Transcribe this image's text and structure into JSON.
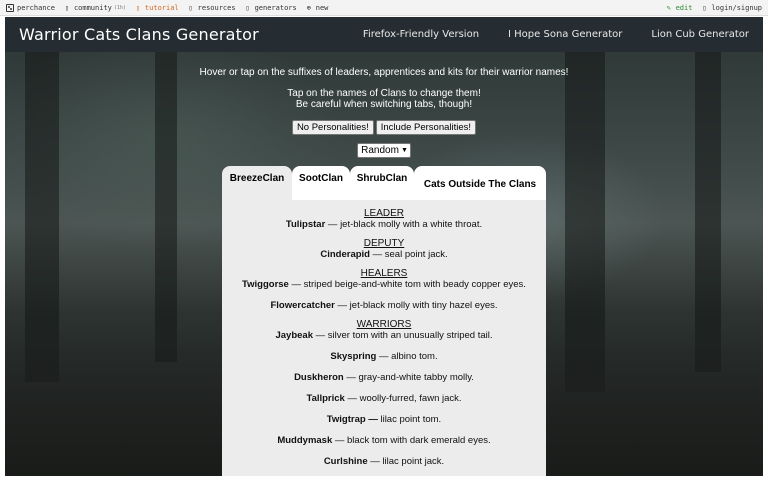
{
  "topbar": {
    "items": [
      {
        "icon": "dice-icon",
        "label": "perchance"
      },
      {
        "icon": "chat-icon",
        "label": "community",
        "badge": "(1h)"
      },
      {
        "icon": "book-icon",
        "label": "tutorial"
      },
      {
        "icon": "box-icon",
        "label": "resources"
      },
      {
        "icon": "gear-icon",
        "label": "generators"
      },
      {
        "icon": "plus-circle-icon",
        "label": "new"
      }
    ],
    "edit_label": "edit",
    "login_label": "login/signup",
    "colors": {
      "tutorial": "#d26a1d",
      "edit": "#2e8b2e"
    }
  },
  "header": {
    "title": "Warrior Cats Clans Generator",
    "nav": [
      "Firefox-Friendly Version",
      "I Hope Sona Generator",
      "Lion Cub Generator"
    ],
    "background": "#262d32"
  },
  "info": {
    "line1": "Hover or tap on the suffixes of leaders, apprentices and kits for their warrior names!",
    "line2": "Tap on the names of Clans to change them!",
    "line3": "Be careful when switching tabs, though!"
  },
  "buttons": {
    "no_personalities": "No Personalities!",
    "include_personalities": "Include Personalities!"
  },
  "select": {
    "value": "Random"
  },
  "tabs": [
    {
      "label": "BreezeClan",
      "active": true
    },
    {
      "label": "SootClan",
      "active": false
    },
    {
      "label": "ShrubClan",
      "active": false
    },
    {
      "label": "Cats Outside The Clans",
      "active": false
    }
  ],
  "clan": {
    "leader_heading": "LEADER",
    "leader": {
      "name": "Tulipstar",
      "desc": " — jet-black molly with a white throat."
    },
    "deputy_heading": "DEPUTY",
    "deputy": {
      "name": "Cinderapid",
      "desc": " — seal point jack."
    },
    "healers_heading": "HEALERS",
    "healers": [
      {
        "name": "Twiggorse",
        "desc": " — striped beige-and-white tom with beady copper eyes."
      },
      {
        "name": "Flowercatcher",
        "desc": " — jet-black molly with tiny hazel eyes."
      }
    ],
    "warriors_heading": "WARRIORS",
    "warriors": [
      {
        "name": "Jaybeak",
        "desc": " — silver tom with an unusually striped tail."
      },
      {
        "name": "Skyspring",
        "desc": " — albino tom."
      },
      {
        "name": "Duskheron",
        "desc": " — gray-and-white tabby molly."
      },
      {
        "name": "Tallprick",
        "desc": " — woolly-furred, fawn jack."
      },
      {
        "name": "Twigtrap —",
        "desc": " lilac point tom."
      },
      {
        "name": "Muddymask",
        "desc": " — black tom with dark emerald eyes."
      },
      {
        "name": "Curlshine",
        "desc": " — lilac point jack."
      }
    ]
  }
}
